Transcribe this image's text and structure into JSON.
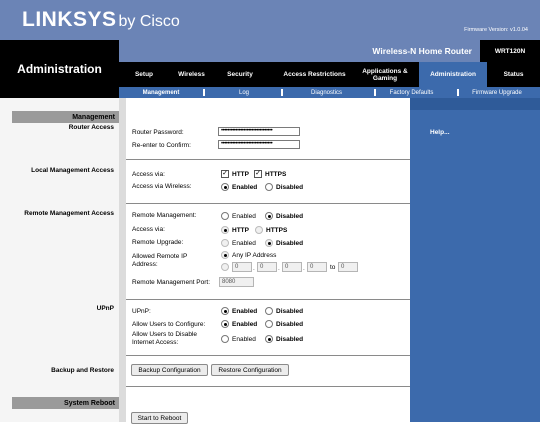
{
  "brand": {
    "logo": "LINKSYS",
    "by": "by Cisco",
    "firmware": "Firmware Version: v1.0.04"
  },
  "section_title": "Administration",
  "product": {
    "name": "Wireless-N Home Router",
    "model": "WRT120N"
  },
  "tabs": [
    {
      "label": "Setup"
    },
    {
      "label": "Wireless"
    },
    {
      "label": "Security"
    },
    {
      "label": "Access Restrictions"
    },
    {
      "label": "Applications & Gaming"
    },
    {
      "label": "Administration"
    },
    {
      "label": "Status"
    }
  ],
  "subtabs": [
    {
      "label": "Management"
    },
    {
      "label": "Log"
    },
    {
      "label": "Diagnostics"
    },
    {
      "label": "Factory Defaults"
    },
    {
      "label": "Firmware Upgrade"
    }
  ],
  "left": {
    "management": "Management",
    "router_access": "Router Access",
    "local_management_access": "Local Management Access",
    "remote_management_access": "Remote Management Access",
    "upnp": "UPnP",
    "backup_restore": "Backup and Restore",
    "system_reboot": "System Reboot"
  },
  "help": {
    "label": "Help..."
  },
  "router_access": {
    "password_label": "Router Password:",
    "password_value": "••••••••••••••••••••••••••••••••",
    "confirm_label": "Re-enter to Confirm:",
    "confirm_value": "••••••••••••••••••••••••••••••••"
  },
  "local": {
    "access_via_label": "Access via:",
    "http": "HTTP",
    "https": "HTTPS",
    "wireless_label": "Access via Wireless:",
    "enabled": "Enabled",
    "disabled": "Disabled"
  },
  "remote": {
    "management_label": "Remote Management:",
    "enabled": "Enabled",
    "disabled": "Disabled",
    "access_via_label": "Access via:",
    "http": "HTTP",
    "https": "HTTPS",
    "upgrade_label": "Remote Upgrade:",
    "allowed_ip_label": "Allowed Remote IP Address:",
    "any_ip": "Any IP Address",
    "ip": [
      "0",
      "0",
      "0",
      "0"
    ],
    "to": "to",
    "ip_end": "0",
    "port_label": "Remote Management Port:",
    "port": "8080"
  },
  "upnp": {
    "upnp_label": "UPnP:",
    "configure_label": "Allow Users to Configure:",
    "disable_label": "Allow Users to Disable Internet Access:",
    "enabled": "Enabled",
    "disabled": "Disabled"
  },
  "backup": {
    "backup_btn": "Backup Configuration",
    "restore_btn": "Restore Configuration"
  },
  "reboot": {
    "btn": "Start to Reboot"
  }
}
